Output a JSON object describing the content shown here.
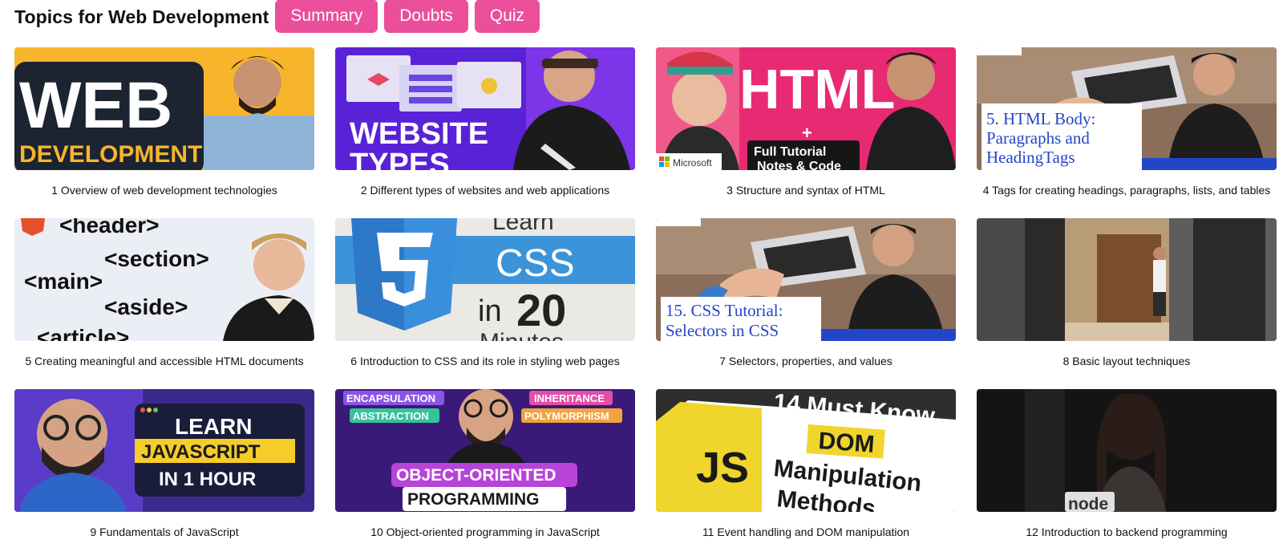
{
  "header": {
    "title": "Topics for Web Development",
    "buttons": [
      {
        "label": "Summary"
      },
      {
        "label": "Doubts"
      },
      {
        "label": "Quiz"
      }
    ]
  },
  "colors": {
    "accent": "#ec4f9a"
  },
  "topics": [
    {
      "caption": "1 Overview of web development technologies",
      "thumb": {
        "title": "WEB",
        "sub": "DEVELOPMENT"
      }
    },
    {
      "caption": "2 Different types of websites and web applications",
      "thumb": {
        "line1": "WEBSITE",
        "line2": "TYPES"
      }
    },
    {
      "caption": "3 Structure and syntax of HTML",
      "thumb": {
        "title": "HTML",
        "plus": "+",
        "box1": "Full Tutorial",
        "box2": "Notes & Code",
        "brand": "Microsoft"
      }
    },
    {
      "caption": "4 Tags for creating headings, paragraphs, lists, and tables",
      "thumb": {
        "line1": "5. HTML Body:",
        "line2": "Paragraphs and",
        "line3": "HeadingTags"
      }
    },
    {
      "caption": "5 Creating meaningful and accessible HTML documents",
      "thumb": {
        "t1": "<header>",
        "t2": "<section>",
        "t3": "<main>",
        "t4": "<aside>",
        "t5": "<article>"
      }
    },
    {
      "caption": "6 Introduction to CSS and its role in styling web pages",
      "thumb": {
        "top": "Learn",
        "css": "CSS",
        "in": "in",
        "num": "20",
        "bottom": "Minutes"
      }
    },
    {
      "caption": "7 Selectors, properties, and values",
      "thumb": {
        "line1": "15. CSS Tutorial:",
        "line2": "Selectors in CSS"
      }
    },
    {
      "caption": "8 Basic layout techniques",
      "thumb": {}
    },
    {
      "caption": "9 Fundamentals of JavaScript",
      "thumb": {
        "l1": "LEARN",
        "l2": "JAVASCRIPT",
        "l3": "IN 1 HOUR"
      }
    },
    {
      "caption": "10 Object-oriented programming in JavaScript",
      "thumb": {
        "tag1": "ENCAPSULATION",
        "tag2": "ABSTRACTION",
        "tag3": "INHERITANCE",
        "tag4": "POLYMORPHISM",
        "b1": "OBJECT-ORIENTED",
        "b2": "PROGRAMMING"
      }
    },
    {
      "caption": "11 Event handling and DOM manipulation",
      "thumb": {
        "top": "14 Must Know",
        "dom": "DOM",
        "js": "JS",
        "l1": "Manipulation",
        "l2": "Methods"
      }
    },
    {
      "caption": "12 Introduction to backend programming",
      "thumb": {
        "logo": "node"
      }
    }
  ]
}
